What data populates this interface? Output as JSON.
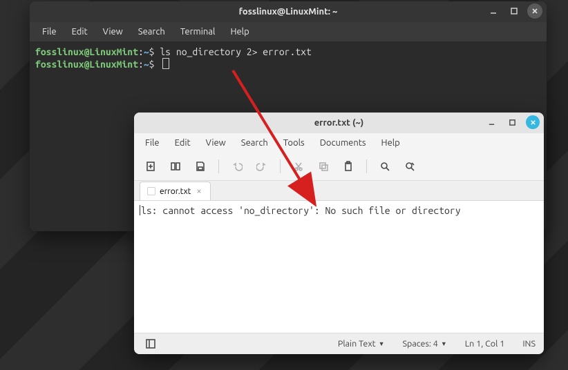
{
  "terminal": {
    "title": "fosslinux@LinuxMint: ~",
    "menu": [
      "File",
      "Edit",
      "View",
      "Search",
      "Terminal",
      "Help"
    ],
    "lines": [
      {
        "user": "fosslinux",
        "at": "@",
        "host": "LinuxMint",
        "sep": ":",
        "path": "~",
        "prompt": "$ ",
        "cmd": "ls no_directory 2> error.txt"
      },
      {
        "user": "fosslinux",
        "at": "@",
        "host": "LinuxMint",
        "sep": ":",
        "path": "~",
        "prompt": "$ ",
        "cmd": ""
      }
    ]
  },
  "editor": {
    "title": "error.txt (~)",
    "menu": [
      "File",
      "Edit",
      "View",
      "Search",
      "Tools",
      "Documents",
      "Help"
    ],
    "toolbar_icons": [
      "new-file-icon",
      "open-file-icon",
      "save-icon",
      "undo-icon",
      "redo-icon",
      "cut-icon",
      "copy-icon",
      "paste-icon",
      "search-icon",
      "replace-icon"
    ],
    "tab": {
      "label": "error.txt"
    },
    "content": "ls: cannot access 'no_directory': No such file or directory",
    "status": {
      "filetype": "Plain Text",
      "spaces": "Spaces: 4",
      "position": "Ln 1, Col 1",
      "mode": "INS"
    }
  }
}
